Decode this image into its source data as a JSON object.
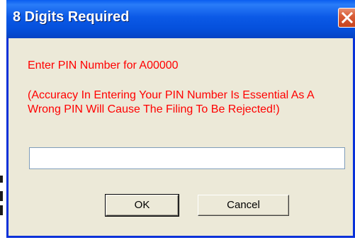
{
  "dialog": {
    "title": "8 Digits Required",
    "prompt": "Enter PIN Number for  A00000",
    "warning": "(Accuracy In Entering Your PIN Number Is Essential As A Wrong PIN Will Cause The Filing To Be Rejected!)",
    "pin_value": "",
    "pin_placeholder": "",
    "ok_label": "OK",
    "cancel_label": "Cancel"
  },
  "colors": {
    "titlebar": "#0554e3",
    "title_text": "#ffffff",
    "body_bg": "#ece9d8",
    "message_text": "#ff0000",
    "close_button": "#d95e38"
  },
  "icons": {
    "close": "close-icon"
  }
}
